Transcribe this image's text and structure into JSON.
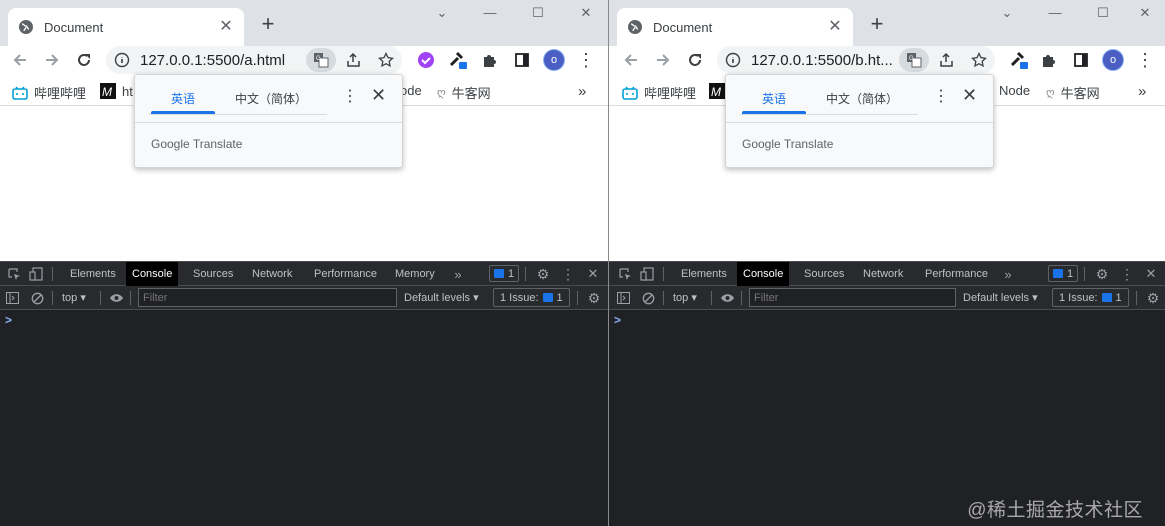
{
  "windows": [
    {
      "tab_title": "Document",
      "url": "127.0.0.1:5500/a.html",
      "avatar_letter": "o",
      "bookmarks": [
        {
          "label": "哔哩哔哩",
          "icon": "bilibili-icon"
        },
        {
          "label": "ht",
          "icon": "m-logo-icon"
        },
        {
          "label": "ode",
          "icon": ""
        },
        {
          "label": "牛客网",
          "icon": "nowcoder-icon"
        }
      ],
      "translate": {
        "lang_en": "英语",
        "lang_zh": "中文（简体）",
        "footer": "Google Translate"
      },
      "devtools": {
        "tabs": [
          "Elements",
          "Console",
          "Sources",
          "Network",
          "Performance",
          "Memory"
        ],
        "active_tab": "Console",
        "issue_badge_count": "1",
        "context": "top",
        "filter_placeholder": "Filter",
        "levels": "Default levels",
        "issues_label": "1 Issue:",
        "issues_count": "1",
        "prompt": ">"
      }
    },
    {
      "tab_title": "Document",
      "url": "127.0.0.1:5500/b.ht...",
      "avatar_letter": "o",
      "bookmarks": [
        {
          "label": "哔哩哔哩",
          "icon": "bilibili-icon"
        },
        {
          "label": "Node",
          "icon": ""
        },
        {
          "label": "牛客网",
          "icon": "nowcoder-icon"
        }
      ],
      "translate": {
        "lang_en": "英语",
        "lang_zh": "中文（简体）",
        "footer": "Google Translate"
      },
      "devtools": {
        "tabs": [
          "Elements",
          "Console",
          "Sources",
          "Network",
          "Performance"
        ],
        "active_tab": "Console",
        "issue_badge_count": "1",
        "context": "top",
        "filter_placeholder": "Filter",
        "levels": "Default levels",
        "issues_label": "1 Issue:",
        "issues_count": "1",
        "prompt": ">"
      }
    }
  ],
  "watermark": "@稀土掘金技术社区",
  "colors": {
    "accent": "#1a73e8",
    "devtools_bg": "#202124",
    "tabstrip": "#dee1e6"
  }
}
